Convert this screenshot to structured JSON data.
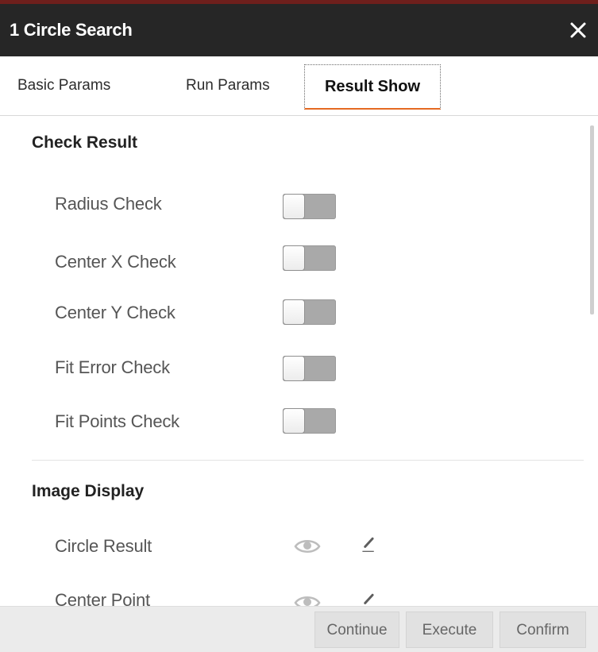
{
  "window": {
    "title": "1 Circle Search"
  },
  "tabs": [
    {
      "label": "Basic Params",
      "active": false
    },
    {
      "label": "Run Params",
      "active": false
    },
    {
      "label": "Result Show",
      "active": true
    }
  ],
  "check_result": {
    "title": "Check Result",
    "items": [
      {
        "label": "Radius Check",
        "enabled": false
      },
      {
        "label": "Center X Check",
        "enabled": false
      },
      {
        "label": "Center Y Check",
        "enabled": false
      },
      {
        "label": "Fit Error Check",
        "enabled": false
      },
      {
        "label": "Fit Points Check",
        "enabled": false
      }
    ]
  },
  "image_display": {
    "title": "Image Display",
    "items": [
      {
        "label": "Circle Result",
        "icons": [
          "eye-icon",
          "pencil-icon"
        ]
      },
      {
        "label": "Center Point",
        "icons": [
          "eye-icon",
          "pencil-icon"
        ]
      }
    ]
  },
  "footer": {
    "continue_label": "Continue",
    "execute_label": "Execute",
    "confirm_label": "Confirm"
  },
  "colors": {
    "titlebar": "#262626",
    "title_accent": "#6e1f1c",
    "active_tab_underline": "#e46a22",
    "toggle_off": "#a9a9a9"
  }
}
